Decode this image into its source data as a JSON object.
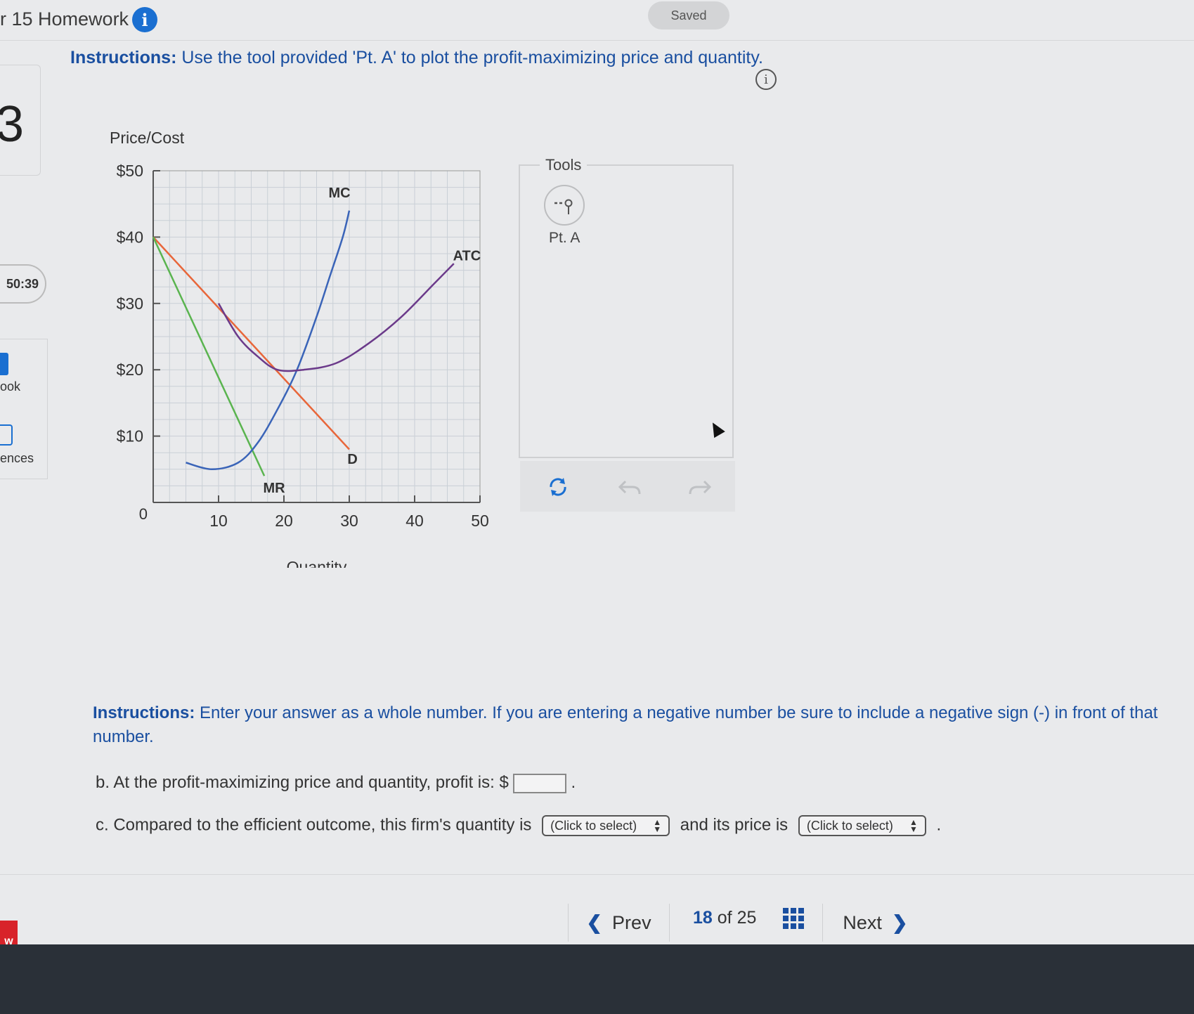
{
  "header": {
    "title": "r 15 Homework",
    "saved": "Saved"
  },
  "instructions1": {
    "bold": "Instructions:",
    "text": " Use the tool provided 'Pt. A' to plot the profit-maximizing price and quantity."
  },
  "sidebar": {
    "number": "3",
    "timer": "50:39",
    "book": "ook",
    "references": "ences",
    "badge": "w"
  },
  "chart_data": {
    "type": "line",
    "ylabel": "Price/Cost",
    "xlabel": "Quantity",
    "y_ticks": [
      "$50",
      "$40",
      "$30",
      "$20",
      "$10"
    ],
    "x_ticks": [
      "10",
      "20",
      "30",
      "40",
      "50"
    ],
    "origin_label": "0",
    "xlim": [
      0,
      50
    ],
    "ylim": [
      0,
      50
    ],
    "grid": true,
    "series": [
      {
        "name": "D",
        "color": "#e8663a",
        "points": [
          [
            0,
            40
          ],
          [
            30,
            8
          ]
        ]
      },
      {
        "name": "MR",
        "color": "#5ab44f",
        "points": [
          [
            0,
            40
          ],
          [
            17,
            4
          ]
        ]
      },
      {
        "name": "MC",
        "color": "#3a64b8",
        "points": [
          [
            5,
            6
          ],
          [
            9,
            5
          ],
          [
            13,
            6
          ],
          [
            16,
            9
          ],
          [
            19,
            14
          ],
          [
            22,
            20
          ],
          [
            25,
            28
          ],
          [
            27,
            34
          ],
          [
            29,
            40
          ],
          [
            30,
            44
          ]
        ]
      },
      {
        "name": "ATC",
        "color": "#6b3a8a",
        "points": [
          [
            10,
            30
          ],
          [
            13,
            25
          ],
          [
            16,
            22
          ],
          [
            19,
            20
          ],
          [
            23,
            20
          ],
          [
            28,
            21
          ],
          [
            33,
            24
          ],
          [
            38,
            28
          ],
          [
            43,
            33
          ],
          [
            46,
            36
          ]
        ]
      }
    ],
    "labels": {
      "D": "D",
      "MR": "MR",
      "MC": "MC",
      "ATC": "ATC"
    }
  },
  "tools": {
    "title": "Tools",
    "point_label": "Pt. A"
  },
  "toolbar_icons": [
    "refresh-icon",
    "undo-icon",
    "redo-icon"
  ],
  "instructions2": {
    "bold": "Instructions:",
    "text": " Enter your answer as a whole number. If you are entering a negative number be sure to include a negative sign (-) in front of that number."
  },
  "question_b": {
    "text": "b. At the profit-maximizing price and quantity, profit is: $",
    "value": "",
    "after": "."
  },
  "question_c": {
    "prefix": "c. Compared to the efficient outcome, this firm's quantity is",
    "select1": "(Click to select)",
    "middle": "and its price is",
    "select2": "(Click to select)",
    "after": "."
  },
  "nav": {
    "prev": "Prev",
    "current": "18",
    "of": "of",
    "total": "25",
    "next": "Next"
  }
}
